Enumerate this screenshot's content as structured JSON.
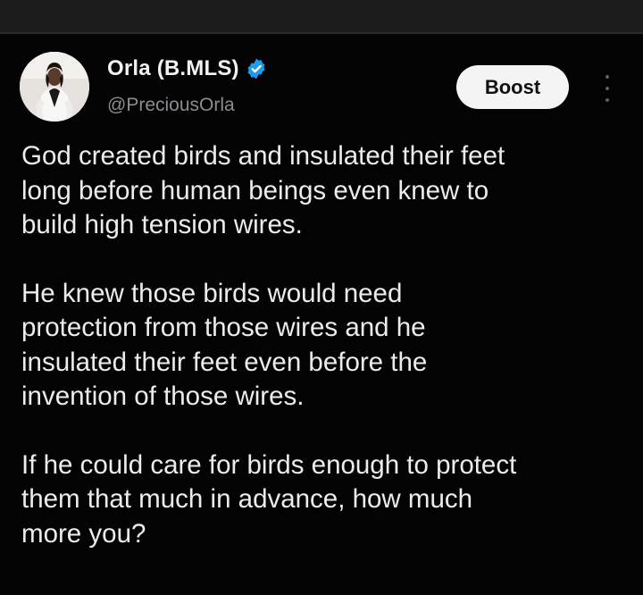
{
  "post": {
    "author": {
      "display_name": "Orla (B.MLS)",
      "handle": "@PreciousOrla",
      "verified": true,
      "verified_color": "#1d9bf0",
      "avatar_icon": "profile-photo"
    },
    "boost_label": "Boost",
    "more_icon": "vertical-ellipsis",
    "paragraphs": [
      "God created birds and insulated their feet\nlong before human beings even knew to\nbuild high tension wires.",
      "He knew those birds would need\nprotection from those wires and he\ninsulated their feet even before the\ninvention of those wires.",
      "If he could care for birds enough to protect\nthem that much in advance, how much\nmore you?"
    ]
  },
  "colors": {
    "background": "#030303",
    "text": "#ececec",
    "secondary_text": "#8a8d91",
    "boost_bg": "#f4f4f4"
  }
}
